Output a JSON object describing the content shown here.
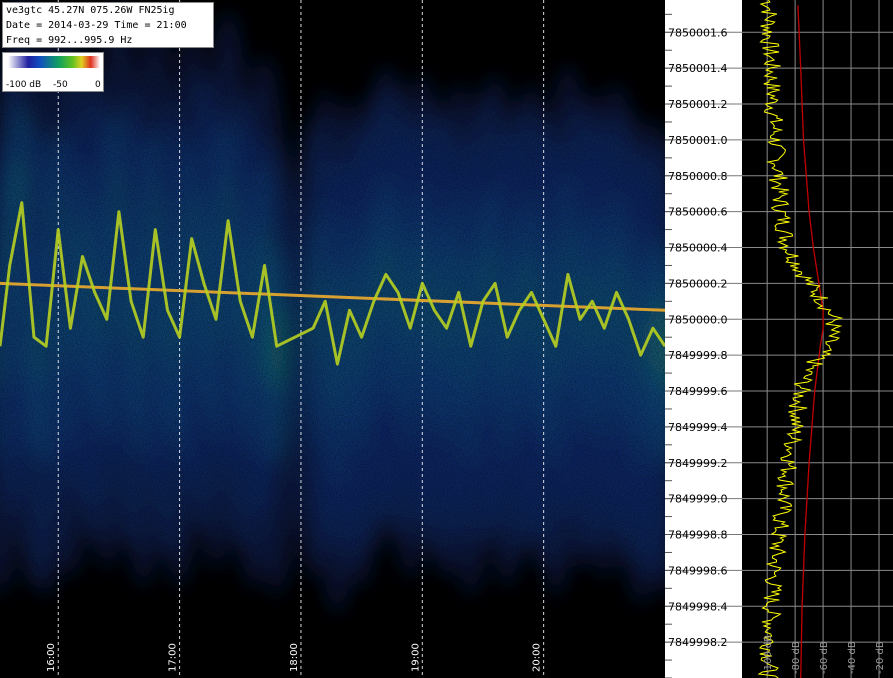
{
  "header": {
    "station": "ve3gtc 45.27N 075.26W FN25ig",
    "date_line": "Date = 2014-03-29 Time = 21:00",
    "freq_line": "Freq = 992...995.9 Hz"
  },
  "colorscale": {
    "labels": [
      "-100 dB",
      "-50",
      "0"
    ]
  },
  "chart_data": [
    {
      "type": "heatmap",
      "title": "",
      "x_tick_labels": [
        "16:00",
        "17:00",
        "18:00",
        "19:00",
        "20:00"
      ],
      "x_ticks_hours": [
        16,
        17,
        18,
        19,
        20
      ],
      "x_range_hours": [
        15.52,
        21.0
      ],
      "y_tick_labels": [
        "7850001.6",
        "7850001.4",
        "7850001.2",
        "7850001.0",
        "7850000.8",
        "7850000.6",
        "7850000.4",
        "7850000.2",
        "7850000.0",
        "7849999.8",
        "7849999.6",
        "7849999.4",
        "7849999.2",
        "7849999.0",
        "7849998.8",
        "7849998.6",
        "7849998.4",
        "7849998.2"
      ],
      "y_ticks": [
        7850001.6,
        7850001.4,
        7850001.2,
        7850001.0,
        7850000.8,
        7850000.6,
        7850000.4,
        7850000.2,
        7850000.0,
        7849999.8,
        7849999.6,
        7849999.4,
        7849999.2,
        7849999.0,
        7849998.8,
        7849998.6,
        7849998.4,
        7849998.2
      ],
      "y_range": [
        7849998.0,
        7850001.78
      ],
      "carrier_center_trend": {
        "x_hours": [
          15.52,
          21.0
        ],
        "y": [
          7850000.2,
          7850000.05
        ]
      },
      "doppler_trace": {
        "x_hours": [
          15.52,
          15.6,
          15.7,
          15.8,
          15.9,
          16.0,
          16.1,
          16.2,
          16.3,
          16.4,
          16.5,
          16.6,
          16.7,
          16.8,
          16.9,
          17.0,
          17.1,
          17.2,
          17.3,
          17.4,
          17.5,
          17.6,
          17.7,
          17.8,
          18.1,
          18.2,
          18.3,
          18.4,
          18.5,
          18.6,
          18.7,
          18.8,
          18.9,
          19.0,
          19.1,
          19.2,
          19.3,
          19.4,
          19.5,
          19.6,
          19.7,
          19.8,
          19.9,
          20.0,
          20.1,
          20.2,
          20.3,
          20.4,
          20.5,
          20.6,
          20.7,
          20.8,
          20.9,
          21.0
        ],
        "y": [
          7849999.85,
          7850000.3,
          7850000.65,
          7849999.9,
          7849999.85,
          7850000.5,
          7849999.95,
          7850000.35,
          7850000.15,
          7850000.0,
          7850000.6,
          7850000.1,
          7849999.9,
          7850000.5,
          7850000.05,
          7849999.9,
          7850000.45,
          7850000.2,
          7850000.0,
          7850000.55,
          7850000.1,
          7849999.9,
          7850000.3,
          7849999.85,
          7849999.95,
          7850000.1,
          7849999.75,
          7850000.05,
          7849999.9,
          7850000.1,
          7850000.25,
          7850000.15,
          7849999.95,
          7850000.2,
          7850000.05,
          7849999.95,
          7850000.15,
          7849999.85,
          7850000.1,
          7850000.2,
          7849999.9,
          7850000.05,
          7850000.15,
          7850000.0,
          7849999.85,
          7850000.25,
          7850000.0,
          7850000.1,
          7849999.95,
          7850000.15,
          7850000.0,
          7849999.8,
          7849999.95,
          7849999.85
        ]
      }
    },
    {
      "type": "line",
      "title": "",
      "x_tick_labels": [
        "-100 dB",
        "-80 dB",
        "-60 dB",
        "-40 dB",
        "-20 dB"
      ],
      "x_ticks": [
        -100,
        -80,
        -60,
        -40,
        -20
      ],
      "xlim": [
        -118,
        -10
      ],
      "series": [
        {
          "color": "#ffff00",
          "y": [
            7850001.75,
            7850001.6,
            7850001.4,
            7850001.2,
            7850001.0,
            7850000.8,
            7850000.6,
            7850000.4,
            7850000.3,
            7850000.2,
            7850000.1,
            7850000.0,
            7849999.9,
            7849999.8,
            7849999.7,
            7849999.6,
            7849999.4,
            7849999.2,
            7849999.0,
            7849998.8,
            7849998.6,
            7849998.4,
            7849998.2,
            7849998.0
          ],
          "x": [
            -98,
            -99,
            -97,
            -96,
            -94,
            -92,
            -90,
            -85,
            -78,
            -70,
            -60,
            -52,
            -55,
            -62,
            -72,
            -76,
            -80,
            -84,
            -88,
            -92,
            -95,
            -97,
            -98,
            -99
          ]
        },
        {
          "color": "#c00000",
          "y": [
            7850001.75,
            7850001.4,
            7850001.0,
            7850000.6,
            7850000.4,
            7850000.2,
            7850000.05,
            7849999.95,
            7849999.85,
            7849999.6,
            7849999.2,
            7849998.8,
            7849998.4,
            7849998.0
          ],
          "x": [
            -78,
            -76,
            -74,
            -70,
            -67,
            -63,
            -60,
            -60,
            -62,
            -66,
            -70,
            -73,
            -75,
            -76
          ]
        }
      ]
    }
  ],
  "colors": {
    "background": "#000000",
    "trace": "#d4b020",
    "grid": "#ffffff",
    "spectrum": "#ffff00",
    "average": "#c00000"
  }
}
